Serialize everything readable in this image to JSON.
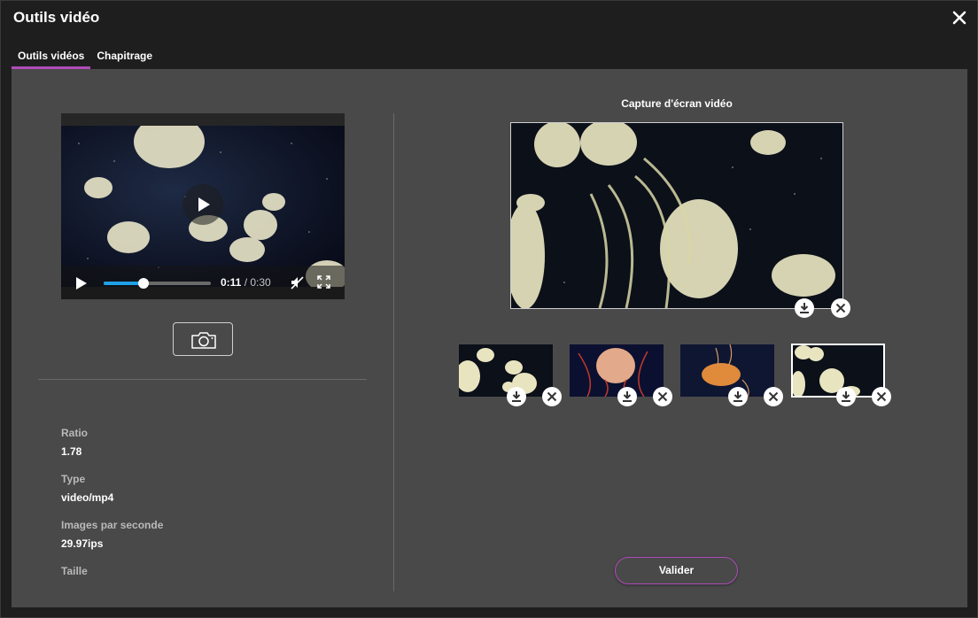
{
  "window": {
    "title": "Outils vidéo",
    "close_icon": "close-icon"
  },
  "tabs": [
    {
      "label": "Outils vidéos",
      "active": true
    },
    {
      "label": "Chapitrage",
      "active": false
    }
  ],
  "player": {
    "current_time": "0:11",
    "separator": " / ",
    "duration": "0:30",
    "progress": 0.37,
    "muted": true,
    "seek_color": "#1ea1e6"
  },
  "screenshot_button": {
    "icon": "camera-icon"
  },
  "metadata": [
    {
      "label": "Ratio",
      "value": "1.78"
    },
    {
      "label": "Type",
      "value": "video/mp4"
    },
    {
      "label": "Images par seconde",
      "value": "29.97ips"
    },
    {
      "label": "Taille",
      "value": ""
    }
  ],
  "capture": {
    "title": "Capture d'écran vidéo",
    "thumbnails": [
      {
        "name": "white-jellyfish",
        "selected": false
      },
      {
        "name": "red-jellyfish",
        "selected": false
      },
      {
        "name": "orange-jellyfish",
        "selected": false
      },
      {
        "name": "white-jellyfish-2",
        "selected": true
      }
    ]
  },
  "actions": {
    "validate_label": "Valider"
  },
  "colors": {
    "accent": "#b04cb8",
    "panel": "#494949",
    "chrome": "#1e1e1e"
  }
}
